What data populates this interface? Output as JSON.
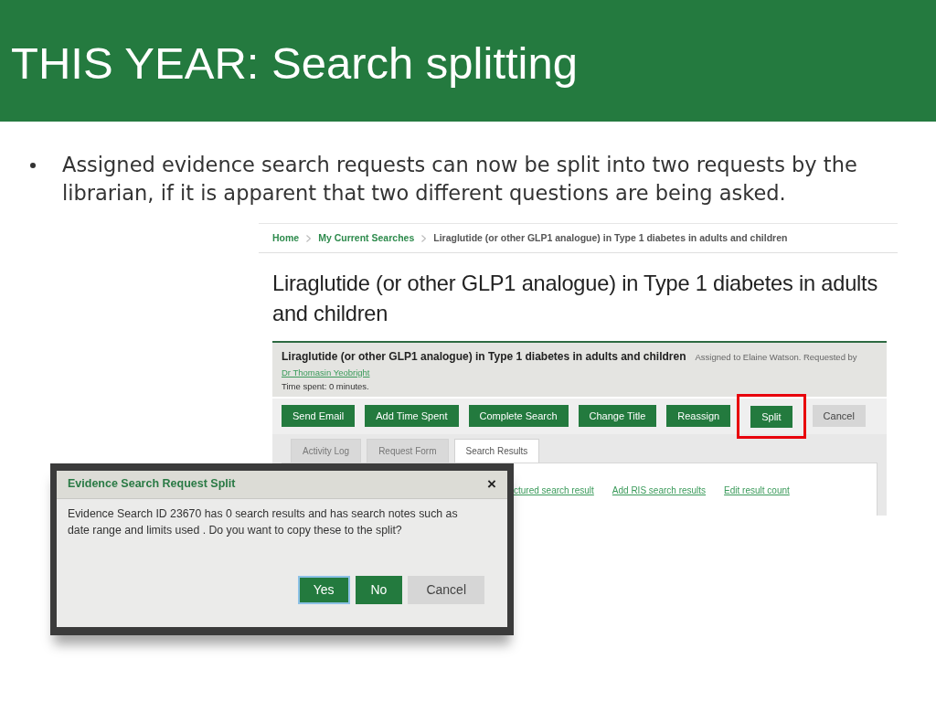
{
  "slide": {
    "title": "THIS YEAR: Search splitting",
    "bullets": [
      "Assigned evidence search requests can now be split into two requests by the librarian, if it is apparent that two different questions are being asked."
    ]
  },
  "screenshot": {
    "breadcrumb": [
      {
        "label": "Home",
        "kind": "link"
      },
      {
        "label": "My Current Searches",
        "kind": "link"
      },
      {
        "label": "Liraglutide (or other GLP1 analogue) in Type 1 diabetes in adults and children",
        "kind": "current"
      }
    ],
    "heading": "Liraglutide (or other GLP1 analogue) in Type 1 diabetes in adults and children",
    "request_panel": {
      "title": "Liraglutide (or other GLP1 analogue) in Type 1 diabetes in adults and children",
      "assigned_text": "Assigned to Elaine Watson. Requested by",
      "requester": "Dr Thomasin Yeobright",
      "time_spent": "Time spent: 0 minutes."
    },
    "actions": [
      {
        "label": "Send Email",
        "kind": "primary",
        "highlighted": false
      },
      {
        "label": "Add Time Spent",
        "kind": "primary",
        "highlighted": false
      },
      {
        "label": "Complete Search",
        "kind": "primary",
        "highlighted": false
      },
      {
        "label": "Change Title",
        "kind": "primary",
        "highlighted": false
      },
      {
        "label": "Reassign",
        "kind": "primary",
        "highlighted": false
      },
      {
        "label": "Split",
        "kind": "primary",
        "highlighted": true
      },
      {
        "label": "Cancel",
        "kind": "default",
        "highlighted": false
      }
    ],
    "tabs": [
      {
        "label": "Activity Log",
        "selected": false
      },
      {
        "label": "Request Form",
        "selected": false
      },
      {
        "label": "Search Results",
        "selected": true
      }
    ],
    "links": [
      "ctured search result",
      "Add RIS search results",
      "Edit result count"
    ]
  },
  "dialog": {
    "title": "Evidence Search Request Split",
    "close": "×",
    "message": "Evidence Search ID 23670 has 0 search results and has search notes such as date range and limits used . Do you want to copy these to the split?",
    "buttons": [
      {
        "label": "Yes",
        "kind": "primary",
        "focused": true
      },
      {
        "label": "No",
        "kind": "primary",
        "focused": false
      },
      {
        "label": "Cancel",
        "kind": "default",
        "focused": false
      }
    ]
  }
}
